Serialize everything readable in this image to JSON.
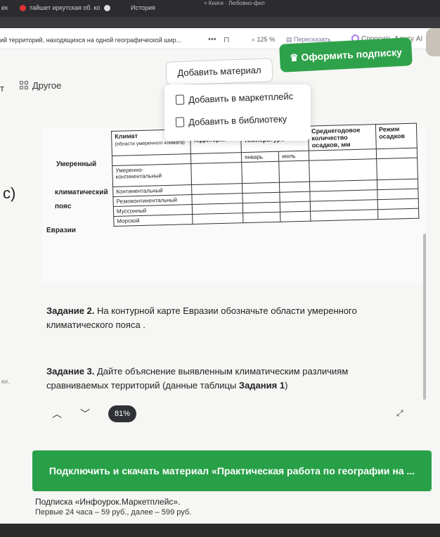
{
  "browser": {
    "tab1": "ек",
    "tab2": "тайшет иркутская об. ко",
    "tab3": "История",
    "sys": "= Книги · Любовно-фил",
    "address_text": "ий территорий, находящихся на одной географической шир...",
    "zoom": "125 %",
    "retell": "Пересказать",
    "alice": "Спросить Алису AI"
  },
  "nav": {
    "t_fragment": "т",
    "other": "Другое",
    "add_material": "Добавить материал",
    "subscribe": "Оформить подписку"
  },
  "dropdown": {
    "marketplace": "Добавить в маркетплейс",
    "library": "Добавить в библиотеку"
  },
  "worksheet": {
    "c_label": "с)",
    "left_labels": [
      "Умеренный",
      "климатический",
      "пояс",
      "Евразии"
    ],
    "headers": [
      "Климат",
      "Соответствует территория",
      "Средняя температура",
      "Среднегодовое количество осадков, мм",
      "Режим осадков"
    ],
    "sub_headers": {
      "climate_note": "(области умеренного климата)",
      "january": "январь",
      "july": "июль"
    },
    "rows": [
      "Умеренно-континентальный",
      "Континентальный",
      "Резкоконтинентальный",
      "Муссонный",
      "Морской"
    ]
  },
  "tasks": {
    "task2_bold": "Задание 2.",
    "task2_text": " На контурной карте Евразии обозначьте области умеренного",
    "task2_text2": "климатического пояса .",
    "task3_bold": "Задание 3.",
    "task3_text": " Дайте объяснение выявленным климатическим различиям",
    "task3_text2": "сравниваемых территорий (данные таблицы ",
    "task3_bold2": "Задания 1",
    "task3_end": ")",
    "side_fragment": "ки."
  },
  "pager": {
    "percent": "81%"
  },
  "download": {
    "label": "Подключить и скачать материал «Практическая работа по географии на ...",
    "subscription": "Подписка «Инфоурок.Маркетплейс».",
    "price": "Первые 24 часа – 59 руб., далее – 599 руб."
  },
  "colors": {
    "green": "#2ea24a",
    "dark": "#2f3136"
  }
}
